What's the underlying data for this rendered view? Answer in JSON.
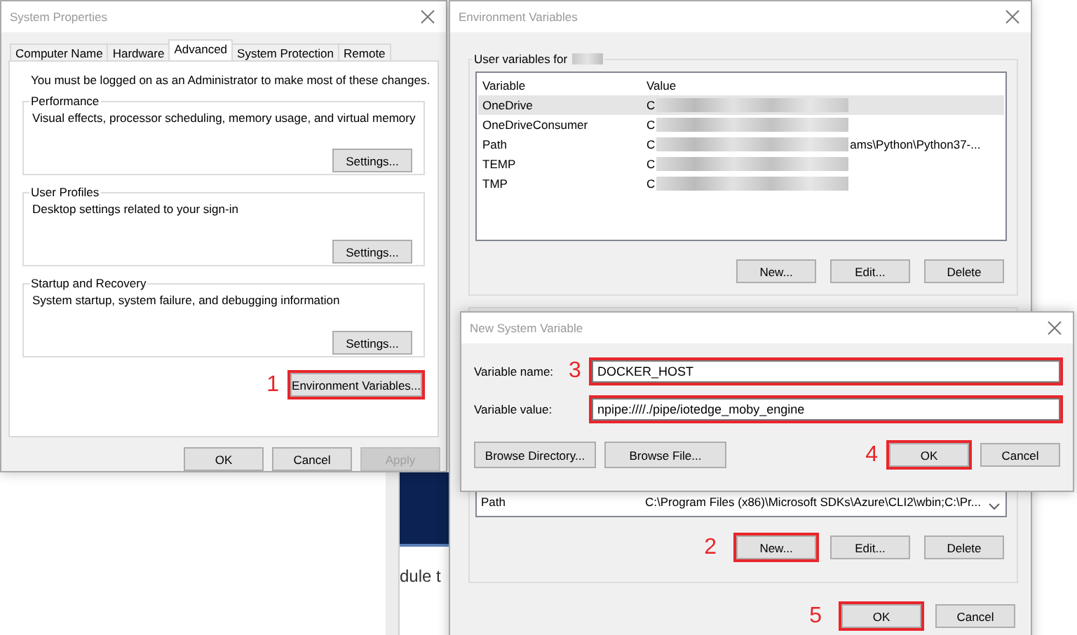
{
  "desktop": {
    "fragment_text": "dule t"
  },
  "system_properties": {
    "title": "System Properties",
    "tabs": [
      {
        "label": "Computer Name",
        "selected": false
      },
      {
        "label": "Hardware",
        "selected": false
      },
      {
        "label": "Advanced",
        "selected": true
      },
      {
        "label": "System Protection",
        "selected": false
      },
      {
        "label": "Remote",
        "selected": false
      }
    ],
    "notice": "You must be logged on as an Administrator to make most of these changes.",
    "groups": [
      {
        "title": "Performance",
        "description": "Visual effects, processor scheduling, memory usage, and virtual memory",
        "button": "Settings..."
      },
      {
        "title": "User Profiles",
        "description": "Desktop settings related to your sign-in",
        "button": "Settings..."
      },
      {
        "title": "Startup and Recovery",
        "description": "System startup, system failure, and debugging information",
        "button": "Settings..."
      }
    ],
    "env_button": {
      "label": "Environment Variables...",
      "marked": true,
      "step": "1"
    },
    "buttons": [
      {
        "label": "OK",
        "disabled": false
      },
      {
        "label": "Cancel",
        "disabled": false
      },
      {
        "label": "Apply",
        "disabled": true
      }
    ]
  },
  "environment_variables": {
    "title": "Environment Variables",
    "user_group_title": "User variables for",
    "columns": [
      "Variable",
      "Value"
    ],
    "user_rows": [
      {
        "variable": "OneDrive",
        "value": "C",
        "selected": true
      },
      {
        "variable": "OneDriveConsumer",
        "value": "C",
        "selected": false
      },
      {
        "variable": "Path",
        "value": "C",
        "value_tail": "ams\\Python\\Python37-...",
        "selected": false
      },
      {
        "variable": "TEMP",
        "value": "C",
        "selected": false
      },
      {
        "variable": "TMP",
        "value": "C",
        "selected": false
      }
    ],
    "user_buttons": [
      {
        "label": "New...",
        "marked": false
      },
      {
        "label": "Edit...",
        "marked": false
      },
      {
        "label": "Delete",
        "marked": false
      }
    ],
    "system_rows": [
      {
        "variable": "Path",
        "value": "C:\\Program Files (x86)\\Microsoft SDKs\\Azure\\CLI2\\wbin;C:\\Pr..."
      }
    ],
    "system_buttons": [
      {
        "label": "New...",
        "marked": true,
        "step": "2"
      },
      {
        "label": "Edit...",
        "marked": false
      },
      {
        "label": "Delete",
        "marked": false
      }
    ],
    "buttons": [
      {
        "label": "OK",
        "marked": true,
        "step": "5"
      },
      {
        "label": "Cancel",
        "marked": false
      }
    ]
  },
  "new_system_variable": {
    "title": "New System Variable",
    "fields": [
      {
        "label": "Variable name:",
        "value": "DOCKER_HOST",
        "marked": true,
        "step": "3"
      },
      {
        "label": "Variable value:",
        "value": "npipe:////./pipe/iotedge_moby_engine",
        "marked": true
      }
    ],
    "browse_buttons": [
      "Browse Directory...",
      "Browse File..."
    ],
    "buttons": [
      {
        "label": "OK",
        "marked": true,
        "step": "4"
      },
      {
        "label": "Cancel",
        "marked": false
      }
    ]
  }
}
